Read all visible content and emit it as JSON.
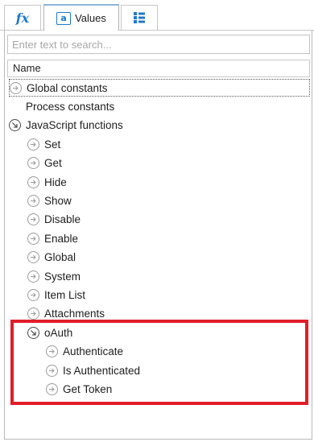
{
  "tabs": {
    "fx_glyph": "fx",
    "values_label": "Values",
    "values_icon_glyph": "a",
    "active": "values"
  },
  "search": {
    "placeholder": "Enter text to search..."
  },
  "list_header": "Name",
  "tree": [
    {
      "label": "Global constants",
      "icon": "collapsed",
      "depth": 0
    },
    {
      "label": "Process constants",
      "icon": "none",
      "depth": 0
    },
    {
      "label": "JavaScript functions",
      "icon": "expanded",
      "depth": 0
    },
    {
      "label": "Set",
      "icon": "collapsed",
      "depth": 1
    },
    {
      "label": "Get",
      "icon": "collapsed",
      "depth": 1
    },
    {
      "label": "Hide",
      "icon": "collapsed",
      "depth": 1
    },
    {
      "label": "Show",
      "icon": "collapsed",
      "depth": 1
    },
    {
      "label": "Disable",
      "icon": "collapsed",
      "depth": 1
    },
    {
      "label": "Enable",
      "icon": "collapsed",
      "depth": 1
    },
    {
      "label": "Global",
      "icon": "collapsed",
      "depth": 1
    },
    {
      "label": "System",
      "icon": "collapsed",
      "depth": 1
    },
    {
      "label": "Item List",
      "icon": "collapsed",
      "depth": 1
    },
    {
      "label": "Attachments",
      "icon": "collapsed",
      "depth": 1
    },
    {
      "label": "oAuth",
      "icon": "expanded",
      "depth": 1
    },
    {
      "label": "Authenticate",
      "icon": "collapsed",
      "depth": 2
    },
    {
      "label": "Is Authenticated",
      "icon": "collapsed",
      "depth": 2
    },
    {
      "label": "Get Token",
      "icon": "collapsed",
      "depth": 2
    }
  ],
  "colors": {
    "accent": "#1f7ac8",
    "highlight": "#e11c2a"
  }
}
